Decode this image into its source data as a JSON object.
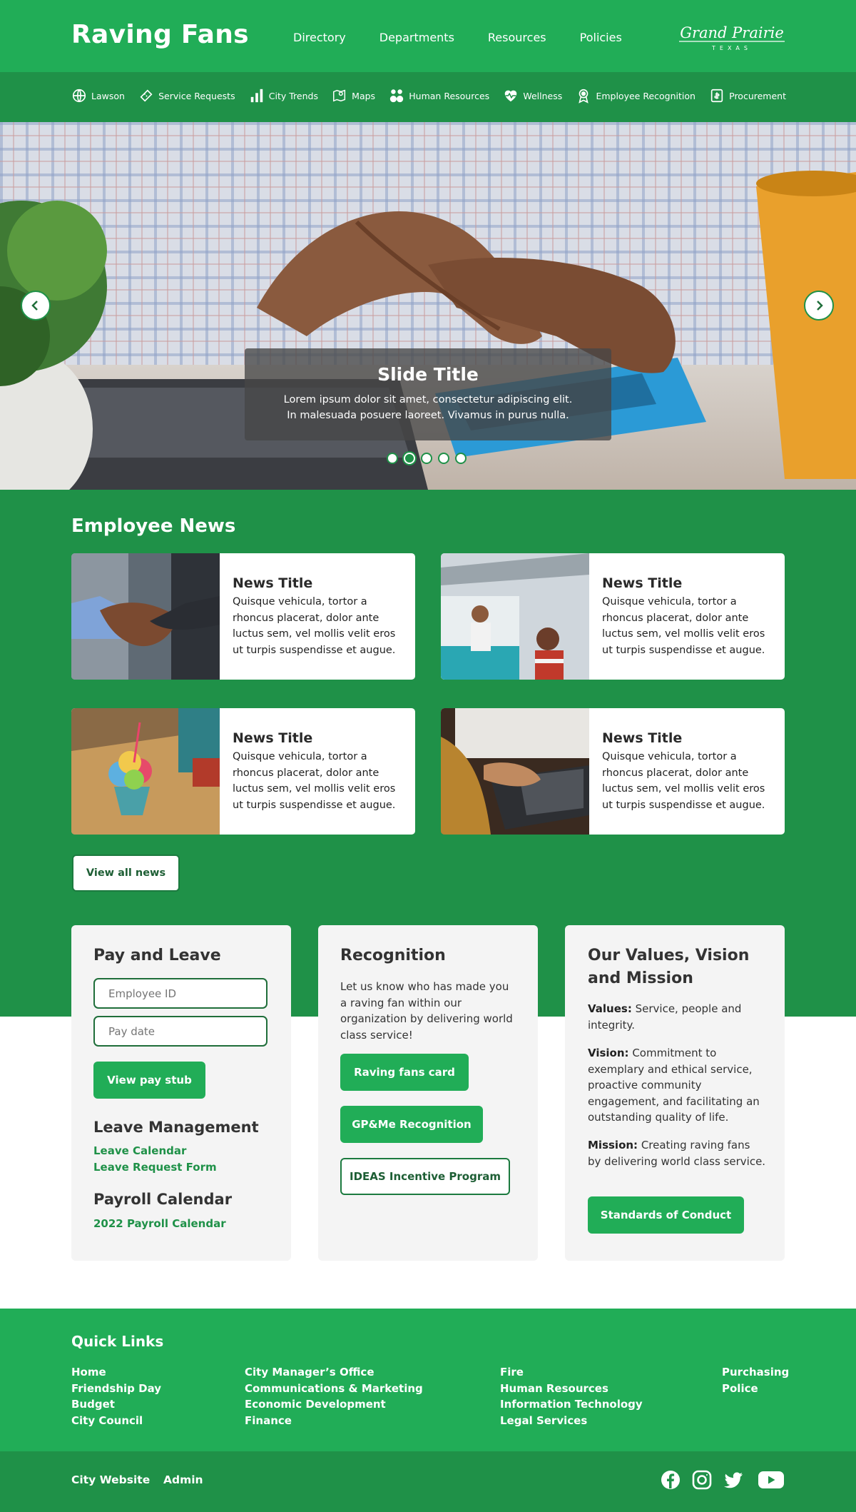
{
  "header": {
    "brand": "Raving Fans",
    "nav": [
      "Directory",
      "Departments",
      "Resources",
      "Policies"
    ],
    "logo_text": "Grand Prairie",
    "logo_subtext": "TEXAS"
  },
  "quicknav": {
    "items": [
      {
        "label": "Lawson",
        "icon": "globe-icon"
      },
      {
        "label": "Service Requests",
        "icon": "ticket-icon"
      },
      {
        "label": "City Trends",
        "icon": "bar-chart-icon"
      },
      {
        "label": "Maps",
        "icon": "map-icon"
      },
      {
        "label": "Human Resources",
        "icon": "people-icon"
      },
      {
        "label": "Wellness",
        "icon": "heart-pulse-icon"
      },
      {
        "label": "Employee Recognition",
        "icon": "award-icon"
      },
      {
        "label": "Procurement",
        "icon": "receipt-icon"
      }
    ]
  },
  "hero": {
    "title": "Slide Title",
    "text": "Lorem ipsum dolor sit amet, consectetur adipiscing elit. In malesuada posuere laoreet. Vivamus in purus nulla.",
    "slides": 5,
    "active_slide": 2
  },
  "news": {
    "heading": "Employee News",
    "items": [
      {
        "title": "News Title",
        "text": "Quisque vehicula, tortor a rhoncus placerat, dolor ante luctus sem, vel mollis velit eros ut turpis suspendisse et augue.",
        "image": "handshake"
      },
      {
        "title": "News Title",
        "text": "Quisque vehicula, tortor a rhoncus placerat, dolor ante luctus sem, vel mollis velit eros ut turpis suspendisse et augue.",
        "image": "food truck"
      },
      {
        "title": "News Title",
        "text": "Quisque vehicula, tortor a rhoncus placerat, dolor ante luctus sem, vel mollis velit eros ut turpis suspendisse et augue.",
        "image": "snow cone"
      },
      {
        "title": "News Title",
        "text": "Quisque vehicula, tortor a rhoncus placerat, dolor ante luctus sem, vel mollis velit eros ut turpis suspendisse et augue.",
        "image": "laptop typing"
      }
    ],
    "view_all": "View all news"
  },
  "pay": {
    "heading": "Pay and Leave",
    "employee_id_placeholder": "Employee ID",
    "pay_date_placeholder": "Pay date",
    "button": "View pay stub",
    "leave_heading": "Leave Management",
    "leave_links": [
      "Leave Calendar",
      "Leave Request Form"
    ],
    "payroll_heading": "Payroll Calendar",
    "payroll_link": "2022 Payroll Calendar"
  },
  "recognition": {
    "heading": "Recognition",
    "text": "Let us know who has made you a raving fan within our organization by delivering world class service!",
    "buttons": [
      "Raving fans card",
      "GP&Me Recognition",
      "IDEAS Incentive Program"
    ]
  },
  "values": {
    "heading": "Our Values, Vision and Mission",
    "values_label": "Values:",
    "values_text": " Service, people and integrity.",
    "vision_label": "Vision:",
    "vision_text": " Commitment to exemplary and ethical service, proactive community engagement, and facilitating an outstanding quality of life.",
    "mission_label": "Mission:",
    "mission_text": " Creating raving fans by delivering world class service.",
    "button": "Standards of Conduct"
  },
  "footer": {
    "heading": "Quick Links",
    "columns": [
      [
        "Home",
        "Friendship Day",
        "Budget",
        "City Council"
      ],
      [
        "City Manager’s Office",
        "Communications & Marketing",
        "Economic Development",
        "Finance"
      ],
      [
        "Fire",
        "Human Resources",
        "Information Technology",
        "Legal Services"
      ],
      [
        "Purchasing",
        "Police"
      ]
    ],
    "bottom_links": [
      "City Website",
      "Admin"
    ],
    "social": [
      "facebook-icon",
      "instagram-icon",
      "twitter-icon",
      "youtube-icon"
    ]
  },
  "colors": {
    "primary_green": "#21ad57",
    "dark_green": "#1f9148",
    "outline_green": "#1c7a3f",
    "panel_bg": "#f4f4f4"
  }
}
